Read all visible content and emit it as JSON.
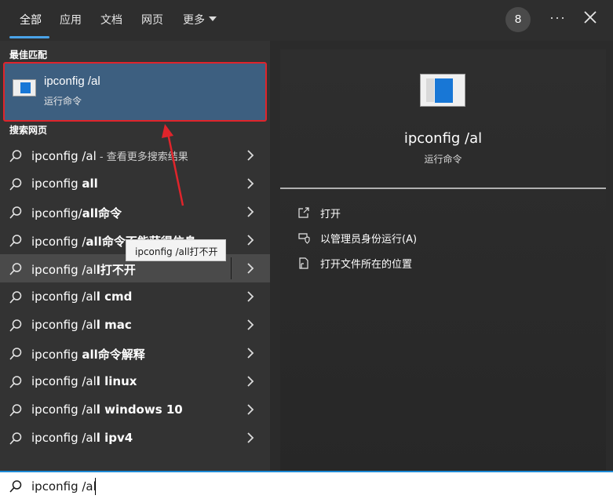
{
  "tabs": [
    {
      "label": "全部"
    },
    {
      "label": "应用"
    },
    {
      "label": "文档"
    },
    {
      "label": "网页"
    },
    {
      "label": "更多"
    }
  ],
  "header": {
    "badge": "8",
    "more_icon": "ellipsis-icon",
    "close_icon": "close-icon"
  },
  "best_match": {
    "section_title": "最佳匹配",
    "title": "ipconfig /al",
    "subtitle": "运行命令",
    "icon": "run-window-icon"
  },
  "web": {
    "section_title": "搜索网页",
    "items": [
      {
        "prefix": "ipconfig /al",
        "bold": "",
        "suffix": " - 查看更多搜索结果"
      },
      {
        "prefix": "ipconfig ",
        "bold": "all",
        "suffix": ""
      },
      {
        "prefix": "ipconfig/",
        "bold": "all命令",
        "suffix": ""
      },
      {
        "prefix": "ipconfig /",
        "bold": "all命令不能获得信息",
        "suffix": ""
      },
      {
        "prefix": "ipconfig /al",
        "bold": "l打不开",
        "suffix": ""
      },
      {
        "prefix": "ipconfig /al",
        "bold": "l cmd",
        "suffix": ""
      },
      {
        "prefix": "ipconfig /al",
        "bold": "l mac",
        "suffix": ""
      },
      {
        "prefix": "ipconfig ",
        "bold": "all命令解释",
        "suffix": ""
      },
      {
        "prefix": "ipconfig /al",
        "bold": "l linux",
        "suffix": ""
      },
      {
        "prefix": "ipconfig /al",
        "bold": "l windows 10",
        "suffix": ""
      },
      {
        "prefix": "ipconfig /al",
        "bold": "l ipv4",
        "suffix": ""
      }
    ]
  },
  "tooltip": "ipconfig /all打不开",
  "preview": {
    "title": "ipconfig /al",
    "subtitle": "运行命令",
    "actions": [
      {
        "label": "打开",
        "icon": "open-icon"
      },
      {
        "label": "以管理员身份运行(A)",
        "icon": "shield-icon"
      },
      {
        "label": "打开文件所在的位置",
        "icon": "file-location-icon"
      }
    ]
  },
  "search": {
    "value": "ipconfig /al"
  },
  "colors": {
    "accent": "#4aa3e8",
    "selection": "#3d5f80",
    "annotation": "#e0242b"
  }
}
